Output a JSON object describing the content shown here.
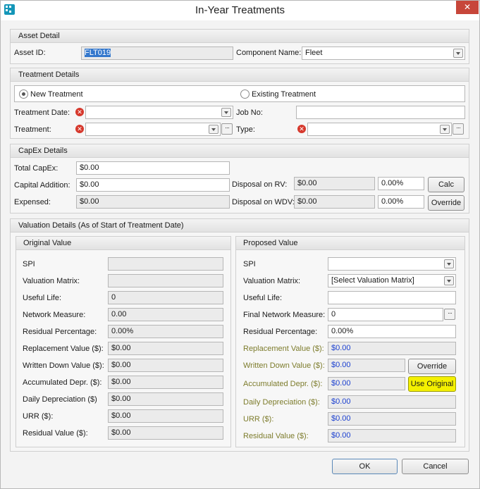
{
  "window": {
    "title": "In-Year Treatments"
  },
  "asset_detail": {
    "heading": "Asset Detail",
    "asset_id_label": "Asset ID:",
    "asset_id_value": "FLT019",
    "component_label": "Component Name:",
    "component_value": "Fleet"
  },
  "treatment_details": {
    "heading": "Treatment Details",
    "radio_new": "New Treatment",
    "radio_existing": "Existing Treatment",
    "selected": "New Treatment",
    "treatment_date_label": "Treatment Date:",
    "job_no_label": "Job No:",
    "treatment_label": "Treatment:",
    "type_label": "Type:"
  },
  "capex_details": {
    "heading": "CapEx Details",
    "total_capex_label": "Total CapEx:",
    "total_capex_value": "$0.00",
    "capital_addition_label": "Capital Addition:",
    "capital_addition_value": "$0.00",
    "expensed_label": "Expensed:",
    "expensed_value": "$0.00",
    "disposal_rv_label": "Disposal on RV:",
    "disposal_rv_value": "$0.00",
    "disposal_rv_pct": "0.00%",
    "disposal_wdv_label": "Disposal on WDV:",
    "disposal_wdv_value": "$0.00",
    "disposal_wdv_pct": "0.00%",
    "calc_button": "Calc",
    "override_button": "Override"
  },
  "valuation_details": {
    "heading": "Valuation Details (As of Start of Treatment Date)",
    "original": {
      "heading": "Original Value",
      "rows": [
        {
          "label": "SPI",
          "value": ""
        },
        {
          "label": "Valuation Matrix:",
          "value": ""
        },
        {
          "label": "Useful Life:",
          "value": "0"
        },
        {
          "label": "Network Measure:",
          "value": "0.00"
        },
        {
          "label": "Residual Percentage:",
          "value": "0.00%"
        },
        {
          "label": "Replacement Value ($):",
          "value": "$0.00"
        },
        {
          "label": "Written Down Value ($):",
          "value": "$0.00"
        },
        {
          "label": "Accumulated Depr. ($):",
          "value": "$0.00"
        },
        {
          "label": "Daily Depreciation ($)",
          "value": "$0.00"
        },
        {
          "label": "URR ($):",
          "value": "$0.00"
        },
        {
          "label": "Residual Value ($):",
          "value": "$0.00"
        }
      ]
    },
    "proposed": {
      "heading": "Proposed Value",
      "spi_label": "SPI",
      "spi_value": "",
      "valuation_matrix_label": "Valuation Matrix:",
      "valuation_matrix_value": "[Select Valuation Matrix]",
      "useful_life_label": "Useful Life:",
      "useful_life_value": "",
      "final_network_label": "Final Network Measure:",
      "final_network_value": "0",
      "residual_pct_label": "Residual Percentage:",
      "residual_pct_value": "0.00%",
      "replacement_label": "Replacement Value ($):",
      "replacement_value": "$0.00",
      "wdv_label": "Written Down Value ($):",
      "wdv_value": "$0.00",
      "override_button": "Override",
      "acc_depr_label": "Accumulated Depr. ($):",
      "acc_depr_value": "$0.00",
      "use_original_button": "Use Original",
      "daily_depr_label": "Daily Depreciation ($):",
      "daily_depr_value": "$0.00",
      "urr_label": "URR ($):",
      "urr_value": "$0.00",
      "residual_value_label": "Residual Value ($):",
      "residual_value_value": "$0.00"
    }
  },
  "footer": {
    "ok_button": "OK",
    "cancel_button": "Cancel"
  },
  "colors": {
    "error": "#d6382c",
    "highlight": "#f4f000",
    "derived_value": "#1a3fd0",
    "derived_label": "#7d7c2c"
  }
}
